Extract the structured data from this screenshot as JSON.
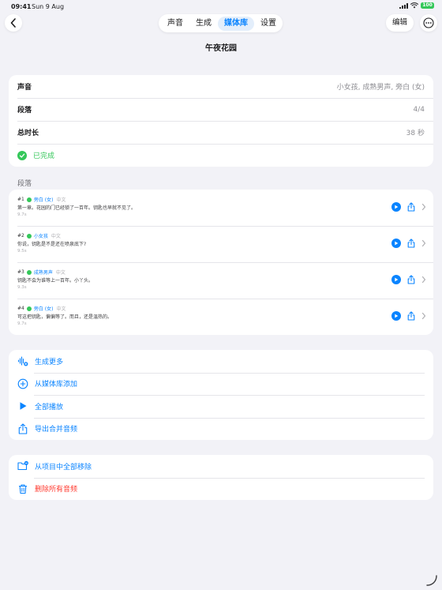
{
  "status": {
    "time": "09:41",
    "date": "Sun 9 Aug",
    "battery": "100"
  },
  "nav": {
    "tabs": [
      {
        "label": "声音"
      },
      {
        "label": "生成"
      },
      {
        "label": "媒体库"
      },
      {
        "label": "设置"
      }
    ],
    "edit_label": "编辑"
  },
  "page": {
    "title": "午夜花园"
  },
  "info": {
    "voice_label": "声音",
    "voice_value": "小女孩, 成熟男声, 旁白 (女)",
    "segments_label": "段落",
    "segments_value": "4/4",
    "duration_label": "总时长",
    "duration_value": "38 秒",
    "status_label": "已完成"
  },
  "segments_header": "段落",
  "segments": [
    {
      "num": "#1",
      "voice": "旁白 (女)",
      "lang": "中文",
      "text": "第一章。花园的门已经锁了一百年。钥匙也早就不见了。",
      "duration": "9.7s"
    },
    {
      "num": "#2",
      "voice": "小女孩",
      "lang": "中文",
      "text": "你说，钥匙是不是还在喷泉底下?",
      "duration": "9.5s"
    },
    {
      "num": "#3",
      "voice": "成熟男声",
      "lang": "中文",
      "text": "钥匙不会为谁等上一百年。小丫头。",
      "duration": "9.3s"
    },
    {
      "num": "#4",
      "voice": "旁白 (女)",
      "lang": "中文",
      "text": "可这把钥匙，偏偏等了。而且，还是温热的。",
      "duration": "9.7s"
    }
  ],
  "actions": {
    "generate_more": "生成更多",
    "add_from_library": "从媒体库添加",
    "play_all": "全部播放",
    "export_merged": "导出合并音频"
  },
  "danger_actions": {
    "remove_all": "从项目中全部移除",
    "delete_all": "删除所有音频"
  },
  "colors": {
    "accent": "#0a84ff",
    "success": "#34c759",
    "danger": "#ff3b30",
    "background": "#f2f2f7"
  }
}
